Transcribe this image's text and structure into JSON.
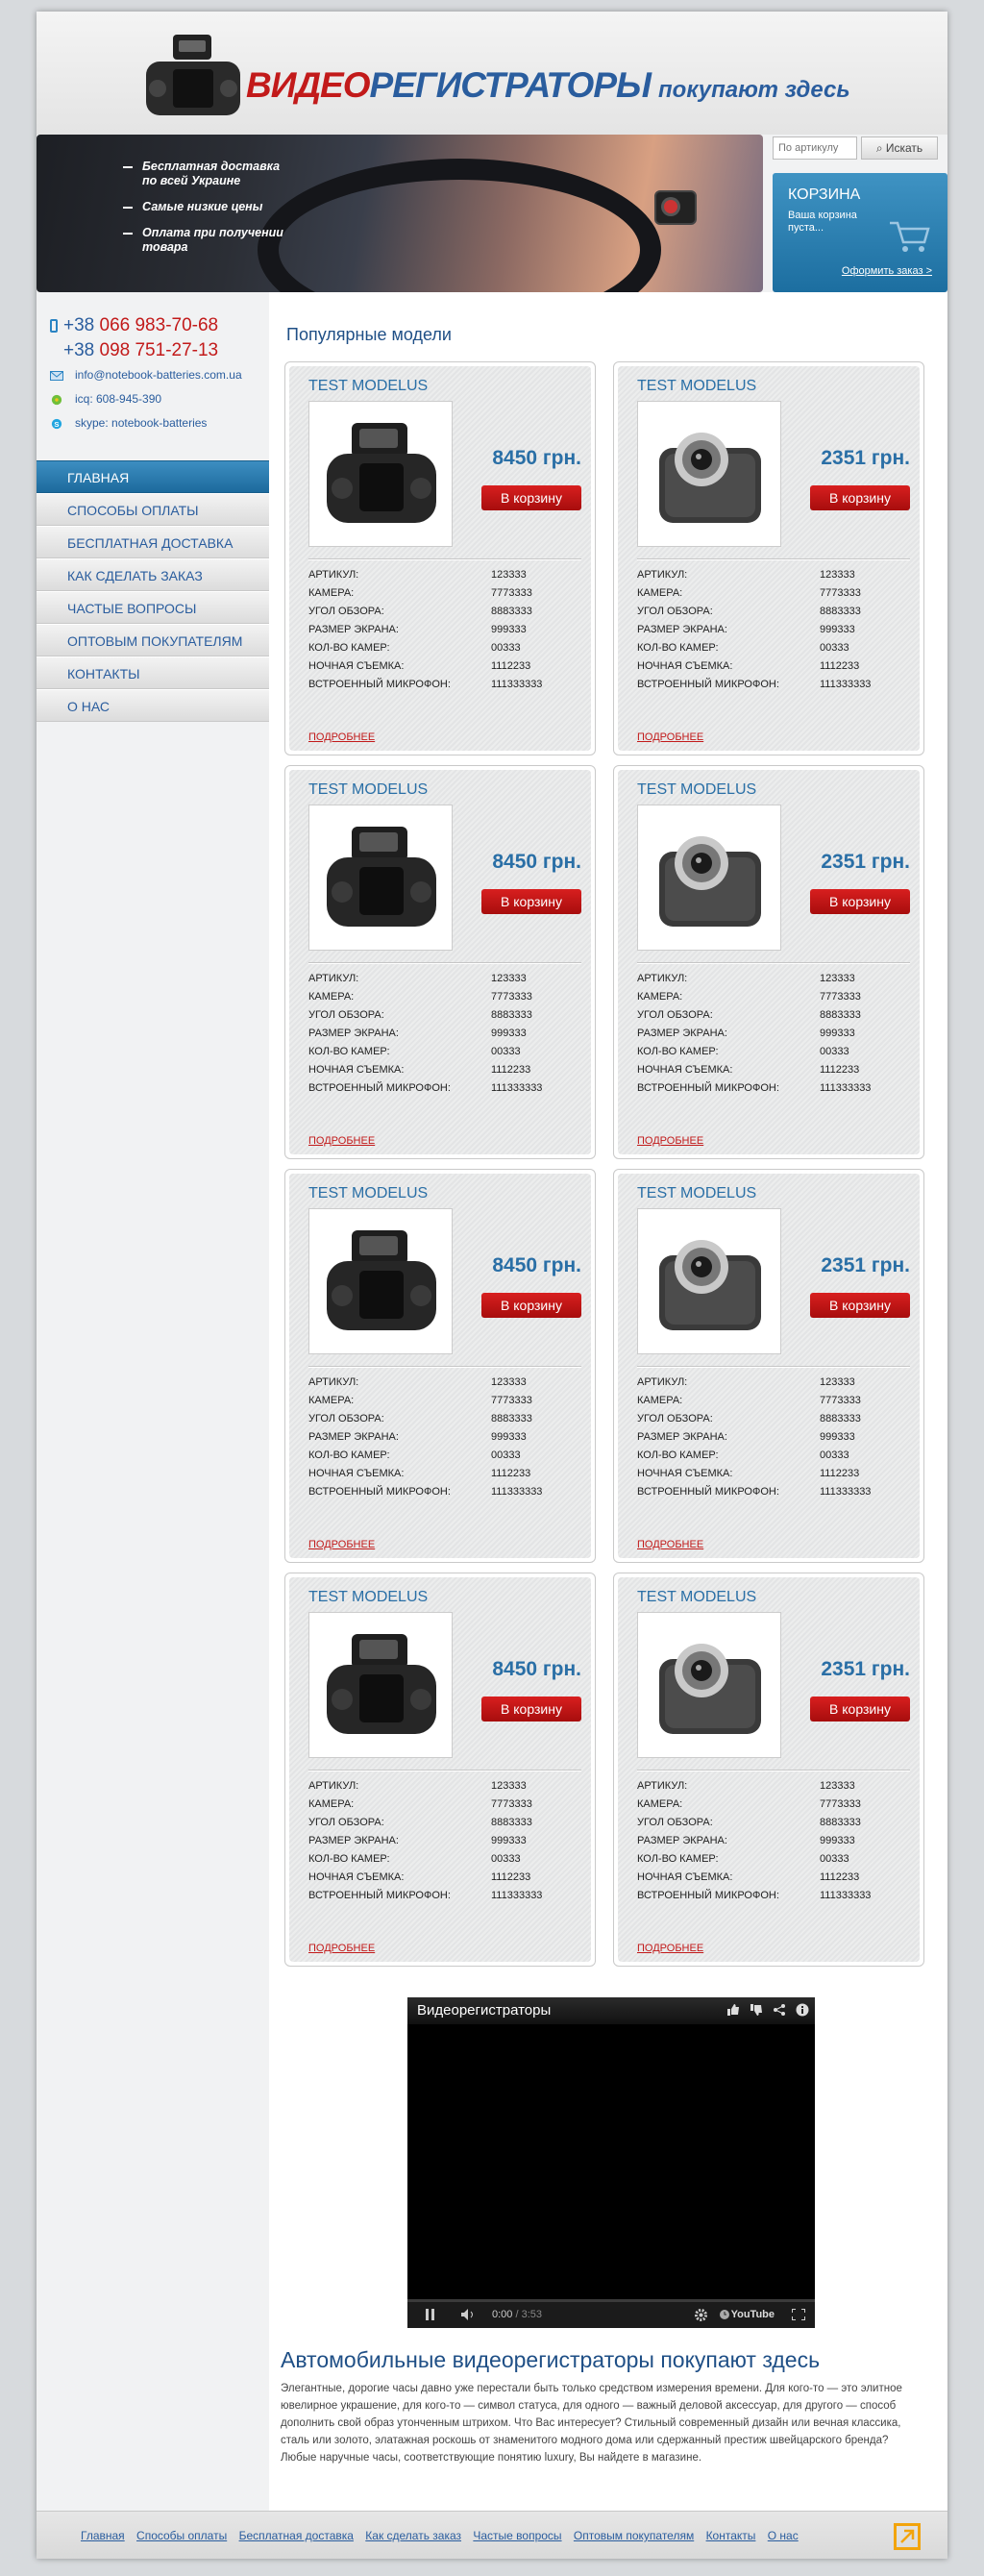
{
  "header": {
    "logo_red": "ВИДЕО",
    "logo_blue": "РЕГИСТРАТОРЫ",
    "logo_tail": "покупают здесь"
  },
  "banner": {
    "bullets": [
      [
        "Бесплатная доставка",
        "по всей Украине"
      ],
      [
        "Самые низкие цены"
      ],
      [
        "Оплата при получении",
        "товара"
      ]
    ]
  },
  "search": {
    "placeholder": "По артикулу",
    "button": "Искать"
  },
  "cart": {
    "title": "КОРЗИНА",
    "text": "Ваша корзина пуста...",
    "order": "Оформить заказ >"
  },
  "contacts": {
    "phones": [
      {
        "prefix": "+38",
        "number": "066 983-70-68"
      },
      {
        "prefix": "+38",
        "number": "098 751-27-13"
      }
    ],
    "email": "info@notebook-batteries.com.ua",
    "icq": "icq: 608-945-390",
    "skype": "skype: notebook-batteries"
  },
  "nav": [
    {
      "label": "ГЛАВНАЯ",
      "active": true
    },
    {
      "label": "СПОСОБЫ ОПЛАТЫ"
    },
    {
      "label": "БЕСПЛАТНАЯ ДОСТАВКА"
    },
    {
      "label": "КАК СДЕЛАТЬ ЗАКАЗ"
    },
    {
      "label": "ЧАСТЫЕ ВОПРОСЫ"
    },
    {
      "label": "ОПТОВЫМ ПОКУПАТЕЛЯМ"
    },
    {
      "label": "КОНТАКТЫ"
    },
    {
      "label": "О НАС"
    }
  ],
  "main": {
    "section_title": "Популярные модели"
  },
  "product_labels": {
    "buy": "В корзину",
    "more": "ПОДРОБНЕЕ",
    "specs": [
      "АРТИКУЛ:",
      "КАМЕРА:",
      "УГОЛ ОБЗОРА:",
      "РАЗМЕР ЭКРАНА:",
      "КОЛ-ВО КАМЕР:",
      "НОЧНАЯ СЪЕМКА:",
      "ВСТРОЕННЫЙ МИКРОФОН:"
    ]
  },
  "products": [
    {
      "name": "TEST MODELUS",
      "price": "8450 грн.",
      "image": "dashcam-black",
      "specs": [
        "123333",
        "7773333",
        "8883333",
        "999333",
        "00333",
        "1112233",
        "111333333"
      ]
    },
    {
      "name": "TEST MODELUS",
      "price": "2351 грн.",
      "image": "dashcam-silver",
      "specs": [
        "123333",
        "7773333",
        "8883333",
        "999333",
        "00333",
        "1112233",
        "111333333"
      ]
    },
    {
      "name": "TEST MODELUS",
      "price": "8450 грн.",
      "image": "dashcam-black",
      "specs": [
        "123333",
        "7773333",
        "8883333",
        "999333",
        "00333",
        "1112233",
        "111333333"
      ]
    },
    {
      "name": "TEST MODELUS",
      "price": "2351 грн.",
      "image": "dashcam-silver",
      "specs": [
        "123333",
        "7773333",
        "8883333",
        "999333",
        "00333",
        "1112233",
        "111333333"
      ]
    },
    {
      "name": "TEST MODELUS",
      "price": "8450 грн.",
      "image": "dashcam-black",
      "specs": [
        "123333",
        "7773333",
        "8883333",
        "999333",
        "00333",
        "1112233",
        "111333333"
      ]
    },
    {
      "name": "TEST MODELUS",
      "price": "2351 грн.",
      "image": "dashcam-silver",
      "specs": [
        "123333",
        "7773333",
        "8883333",
        "999333",
        "00333",
        "1112233",
        "111333333"
      ]
    },
    {
      "name": "TEST MODELUS",
      "price": "8450 грн.",
      "image": "dashcam-black",
      "specs": [
        "123333",
        "7773333",
        "8883333",
        "999333",
        "00333",
        "1112233",
        "111333333"
      ]
    },
    {
      "name": "TEST MODELUS",
      "price": "2351 грн.",
      "image": "dashcam-silver",
      "specs": [
        "123333",
        "7773333",
        "8883333",
        "999333",
        "00333",
        "1112233",
        "111333333"
      ]
    }
  ],
  "video": {
    "title": "Видеорегистраторы",
    "time_current": "0:00",
    "time_total": "/ 3:53",
    "brand": "YouTube"
  },
  "seo": {
    "title": "Автомобильные видеорегистраторы покупают здесь",
    "text": "Элегантные, дорогие часы давно уже перестали быть только средством измерения времени. Для кого-то — это элитное ювелирное украшение, для кого-то — символ статуса, для одного — важный деловой аксессуар, для другого — способ дополнить свой образ утонченным штрихом. Что Вас интересует? Стильный современный дизайн или вечная классика, сталь или золото, элатажная роскошь от знаменитого модного дома или сдержанный престиж швейцарского бренда? Любые наручные часы, соответствующие понятию luxury, Вы найдете в магазине."
  },
  "footer": {
    "links": [
      "Главная",
      "Способы оплаты",
      "Бесплатная доставка",
      "Как сделать заказ",
      "Частые вопросы",
      "Оптовым покупателям",
      "Контакты",
      "О нас"
    ]
  },
  "colors": {
    "accent": "#2a5d9e",
    "price": "#2a6fa6",
    "buy": "#c41616",
    "footer_icon": "#f2a40c"
  }
}
